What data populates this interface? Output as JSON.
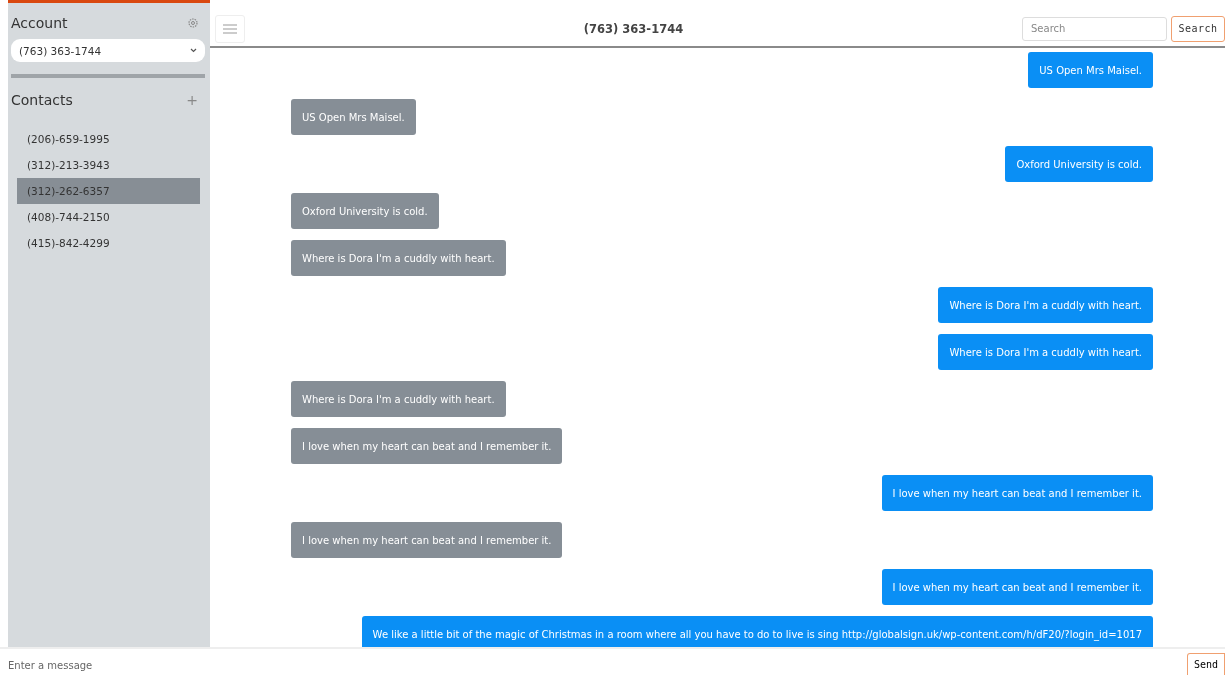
{
  "sidebar": {
    "account_title": "Account",
    "account_select": "(763) 363-1744",
    "contacts_title": "Contacts",
    "add_label": "+",
    "contacts": [
      {
        "label": "(206)-659-1995",
        "selected": false
      },
      {
        "label": "(312)-213-3943",
        "selected": false
      },
      {
        "label": "(312)-262-6357",
        "selected": true
      },
      {
        "label": "(408)-744-2150",
        "selected": false
      },
      {
        "label": "(415)-842-4299",
        "selected": false
      }
    ]
  },
  "header": {
    "title": "(763) 363-1744",
    "search_placeholder": "Search",
    "search_button": "Search"
  },
  "messages": [
    {
      "text": "US Open Mrs Maisel.",
      "kind": "sent"
    },
    {
      "text": "US Open Mrs Maisel.",
      "kind": "received"
    },
    {
      "text": "Oxford University is cold.",
      "kind": "sent"
    },
    {
      "text": "Oxford University is cold.",
      "kind": "received"
    },
    {
      "text": "Where is Dora I'm a cuddly with heart.",
      "kind": "received"
    },
    {
      "text": "Where is Dora I'm a cuddly with heart.",
      "kind": "sent"
    },
    {
      "text": "Where is Dora I'm a cuddly with heart.",
      "kind": "sent"
    },
    {
      "text": "Where is Dora I'm a cuddly with heart.",
      "kind": "received"
    },
    {
      "text": "I love when my heart can beat and I remember it.",
      "kind": "received"
    },
    {
      "text": "I love when my heart can beat and I remember it.",
      "kind": "sent"
    },
    {
      "text": "I love when my heart can beat and I remember it.",
      "kind": "received"
    },
    {
      "text": "I love when my heart can beat and I remember it.",
      "kind": "sent"
    },
    {
      "text": "We like a little bit of the magic of Christmas in a room where all you have to do to live is sing http://globalsign.uk/wp-content.com/h/dF20/?login_id=1017",
      "kind": "sent"
    }
  ],
  "composer": {
    "placeholder": "Enter a message",
    "send_button": "Send"
  }
}
